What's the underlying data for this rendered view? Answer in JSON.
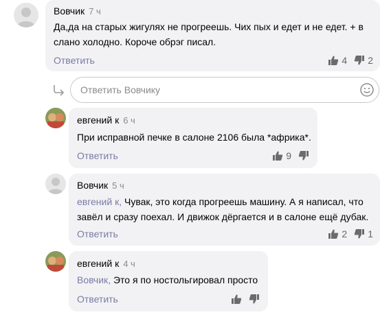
{
  "comments": [
    {
      "author": "Вовчик",
      "time": "7 ч",
      "text_lines": [
        "Да,да на старых жигулях не прогреешь. Чих пых и едет и не едет. + в",
        "слано холодно. Короче обрэг писал."
      ],
      "reply_label": "Ответить",
      "likes": "4",
      "dislikes": "2"
    },
    {
      "author": "евгений к",
      "time": "6 ч",
      "text_lines": [
        "При исправной печке в салоне 2106 была *африка*."
      ],
      "reply_label": "Ответить",
      "likes": "9",
      "dislikes": ""
    },
    {
      "author": "Вовчик",
      "time": "5 ч",
      "mention": "евгений к,",
      "text_lines": [
        " Чувак, это когда прогреешь машину. А я написал, что",
        "завёл и сразу поехал. И движок дёргается и в салоне ещё дубак."
      ],
      "reply_label": "Ответить",
      "likes": "2",
      "dislikes": "1"
    },
    {
      "author": "евгений к",
      "time": "4 ч",
      "mention": "Вовчик,",
      "text_lines": [
        " Это я по ностольгировал просто"
      ],
      "reply_label": "Ответить",
      "likes": "",
      "dislikes": ""
    }
  ],
  "reply_box": {
    "placeholder": "Ответить Вовчику"
  },
  "colors": {
    "bubble": "#f2f2f4",
    "link": "#7a7aa8",
    "muted": "#8b8b8b"
  }
}
